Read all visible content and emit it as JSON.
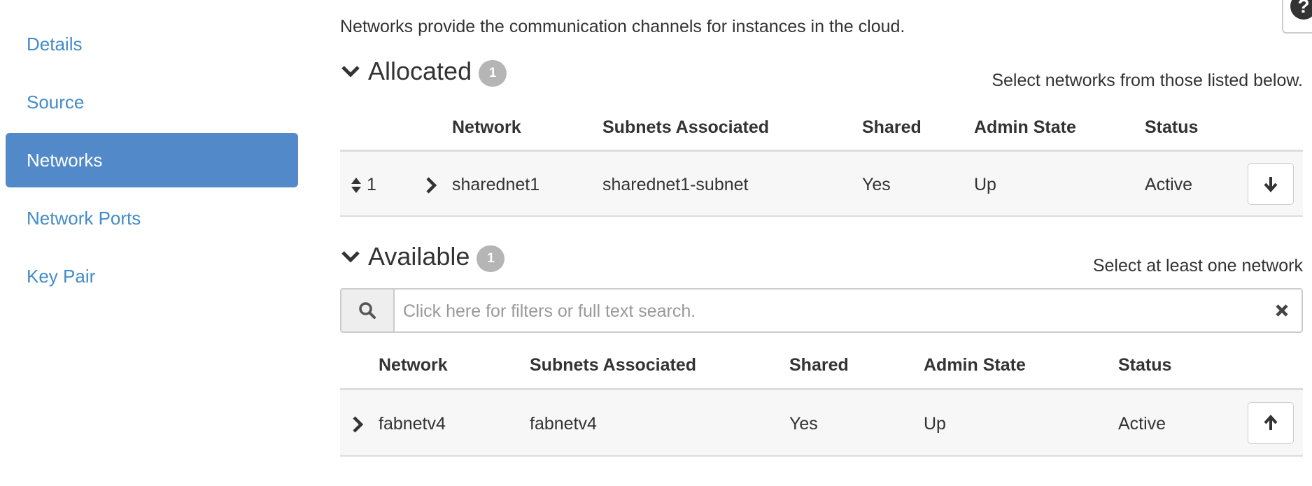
{
  "sidebar": {
    "items": [
      {
        "label": "Details",
        "active": false
      },
      {
        "label": "Source",
        "active": false
      },
      {
        "label": "Networks",
        "active": true
      },
      {
        "label": "Network Ports",
        "active": false
      },
      {
        "label": "Key Pair",
        "active": false
      }
    ]
  },
  "help_icon": "?",
  "main": {
    "description": "Networks provide the communication channels for instances in the cloud.",
    "allocated": {
      "title": "Allocated",
      "count": "1",
      "hint": "Select networks from those listed below.",
      "columns": [
        "Network",
        "Subnets Associated",
        "Shared",
        "Admin State",
        "Status"
      ],
      "rows": [
        {
          "order": "1",
          "network": "sharednet1",
          "subnets": "sharednet1-subnet",
          "shared": "Yes",
          "admin_state": "Up",
          "status": "Active"
        }
      ]
    },
    "available": {
      "title": "Available",
      "count": "1",
      "hint": "Select at least one network",
      "search": {
        "placeholder": "Click here for filters or full text search.",
        "value": ""
      },
      "columns": [
        "Network",
        "Subnets Associated",
        "Shared",
        "Admin State",
        "Status"
      ],
      "rows": [
        {
          "network": "fabnetv4",
          "subnets": "fabnetv4",
          "shared": "Yes",
          "admin_state": "Up",
          "status": "Active"
        }
      ]
    }
  },
  "icons": {
    "section_toggle": "chevron-down-icon",
    "row_expand": "chevron-right-icon",
    "reorder": "sort-arrows-icon",
    "deallocate": "arrow-down-icon",
    "allocate": "arrow-up-icon",
    "search": "search-icon",
    "clear": "close-icon",
    "help": "help-icon"
  },
  "colors": {
    "accent": "#5289c9",
    "link": "#428bca",
    "badge": "#b5b5b5",
    "row_bg": "#f7f7f7"
  }
}
